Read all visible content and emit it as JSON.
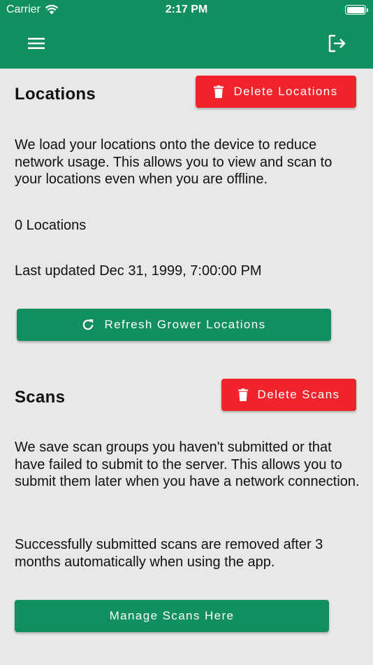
{
  "status_bar": {
    "carrier": "Carrier",
    "time": "2:17 PM"
  },
  "header": {
    "menu_icon": "hamburger-icon",
    "logout_icon": "logout-icon"
  },
  "colors": {
    "brand_green": "#118f5e",
    "danger_red": "#f2232a",
    "background": "#e8e8e8"
  },
  "locations": {
    "title": "Locations",
    "delete_label": "Delete Locations",
    "description": "We load your locations onto the device to reduce network usage. This allows you to view and scan to your locations even when you are offline.",
    "count": "0 Locations",
    "last_updated": "Last updated Dec 31, 1999, 7:00:00 PM",
    "refresh_label": "Refresh Grower Locations"
  },
  "scans": {
    "title": "Scans",
    "delete_label": "Delete Scans",
    "description": "We save scan groups you haven't submitted or that have failed to submit to the server. This allows you to submit them later when you have a network connection.",
    "retention_note": "Successfully submitted scans are removed after 3 months automatically when using the app.",
    "manage_label": "Manage Scans Here"
  }
}
